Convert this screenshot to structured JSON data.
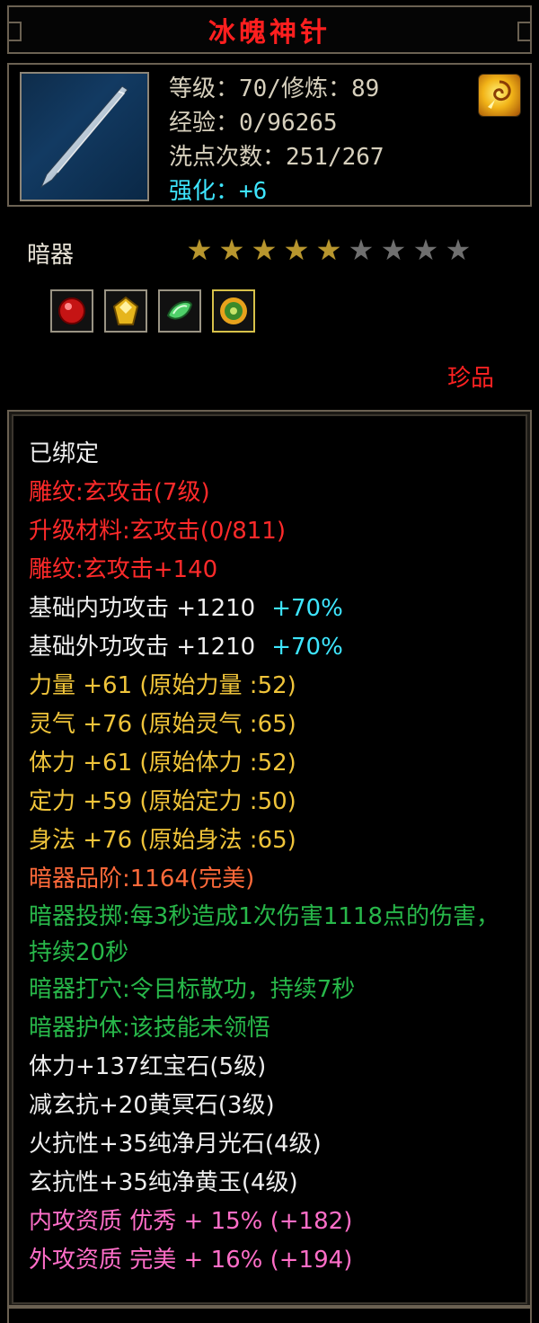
{
  "title": "冰魄神针",
  "item": {
    "icon_name": "ice-needle-icon",
    "level_line": "等级：70/修炼：89",
    "exp_line": "经验：0/96265",
    "reset_line": "洗点次数：251/267",
    "enhance_line": "强化：+6",
    "badge_icon": "golden-swirl-badge-icon"
  },
  "category": "暗器",
  "stars": {
    "filled": 5,
    "total": 9
  },
  "gems": [
    {
      "name": "ruby-gem-icon",
      "color": "#d81818"
    },
    {
      "name": "yellow-gem-icon",
      "color": "#e6b51c"
    },
    {
      "name": "moonstone-gem-icon",
      "color": "#4fd06a"
    },
    {
      "name": "jade-gem-icon",
      "color": "#e7a21c"
    }
  ],
  "rarity": "珍品",
  "attributes": [
    {
      "text": "已绑定",
      "color": "white"
    },
    {
      "text": "雕纹:玄攻击(7级)",
      "color": "red"
    },
    {
      "text": "升级材料:玄攻击(0/811)",
      "color": "red"
    },
    {
      "text": "雕纹:玄攻击+140",
      "color": "red"
    },
    {
      "text": "基础内功攻击 +1210",
      "extra": "+70%",
      "color": "white"
    },
    {
      "text": "基础外功攻击 +1210",
      "extra": "+70%",
      "color": "white"
    },
    {
      "text": "力量 +61 (原始力量 :52)",
      "color": "yellow"
    },
    {
      "text": "灵气 +76 (原始灵气 :65)",
      "color": "yellow"
    },
    {
      "text": "体力 +61 (原始体力 :52)",
      "color": "yellow"
    },
    {
      "text": "定力 +59 (原始定力 :50)",
      "color": "yellow"
    },
    {
      "text": "身法 +76 (原始身法 :65)",
      "color": "yellow"
    },
    {
      "text": "暗器品阶:1164(完美)",
      "color": "orange"
    },
    {
      "text": "暗器投掷:每3秒造成1次伤害1118点的伤害，持续20秒",
      "color": "green",
      "wrap": true
    },
    {
      "text": "暗器打穴:令目标散功，持续7秒",
      "color": "green"
    },
    {
      "text": "暗器护体:该技能未领悟",
      "color": "green"
    },
    {
      "text": "体力+137红宝石(5级)",
      "color": "white"
    },
    {
      "text": "减玄抗+20黄冥石(3级)",
      "color": "white"
    },
    {
      "text": "火抗性+35纯净月光石(4级)",
      "color": "white"
    },
    {
      "text": "玄抗性+35纯净黄玉(4级)",
      "color": "white"
    },
    {
      "text": "内攻资质 优秀 + 15% (+182)",
      "color": "pink"
    },
    {
      "text": "外攻资质 完美 + 16% (+194)",
      "color": "pink"
    }
  ]
}
